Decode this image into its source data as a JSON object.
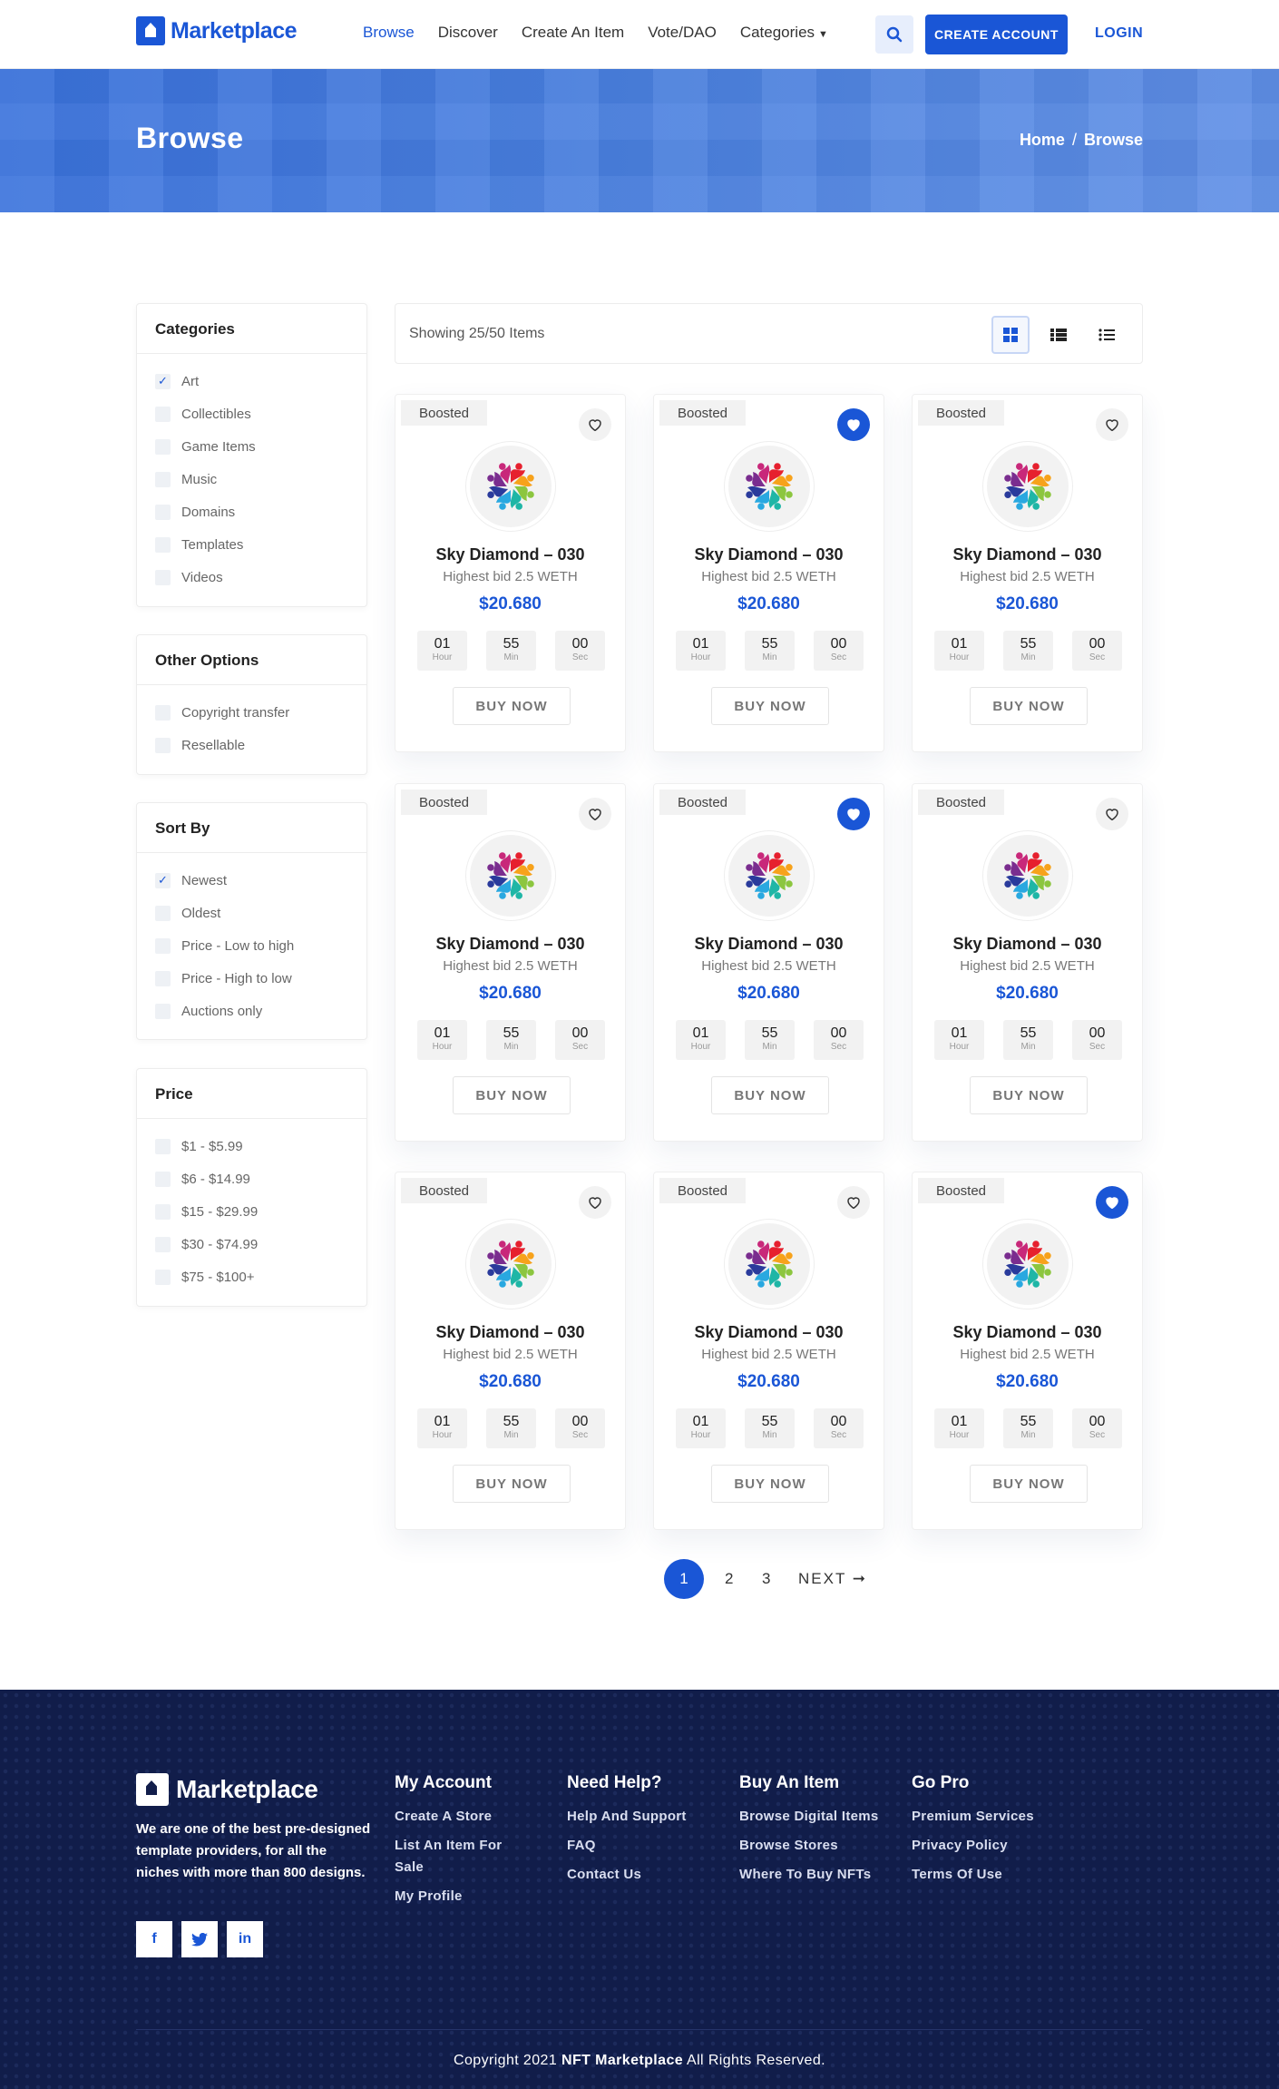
{
  "header": {
    "brand": "Marketplace",
    "nav": [
      "Browse",
      "Discover",
      "Create An Item",
      "Vote/DAO",
      "Categories"
    ],
    "create_account": "CREATE ACCOUNT",
    "login": "LOGIN"
  },
  "banner": {
    "title": "Browse",
    "breadcrumb_home": "Home",
    "breadcrumb_sep": "/",
    "breadcrumb_current": "Browse"
  },
  "sidebar": {
    "categories": {
      "title": "Categories",
      "items": [
        {
          "label": "Art",
          "checked": true
        },
        {
          "label": "Collectibles",
          "checked": false
        },
        {
          "label": "Game Items",
          "checked": false
        },
        {
          "label": "Music",
          "checked": false
        },
        {
          "label": "Domains",
          "checked": false
        },
        {
          "label": "Templates",
          "checked": false
        },
        {
          "label": "Videos",
          "checked": false
        }
      ]
    },
    "other": {
      "title": "Other Options",
      "items": [
        {
          "label": "Copyright transfer",
          "checked": false
        },
        {
          "label": "Resellable",
          "checked": false
        }
      ]
    },
    "sort": {
      "title": "Sort By",
      "items": [
        {
          "label": "Newest",
          "checked": true
        },
        {
          "label": "Oldest",
          "checked": false
        },
        {
          "label": "Price - Low to high",
          "checked": false
        },
        {
          "label": "Price - High to low",
          "checked": false
        },
        {
          "label": "Auctions only",
          "checked": false
        }
      ]
    },
    "price": {
      "title": "Price",
      "items": [
        {
          "label": "$1 - $5.99",
          "checked": false
        },
        {
          "label": "$6 - $14.99",
          "checked": false
        },
        {
          "label": "$15 - $29.99",
          "checked": false
        },
        {
          "label": "$30 - $74.99",
          "checked": false
        },
        {
          "label": "$75 - $100+",
          "checked": false
        }
      ]
    }
  },
  "results": {
    "showing": "Showing 25/50 Items"
  },
  "cards": [
    {
      "badge": "Boosted",
      "liked": false,
      "name": "Sky Diamond – 030",
      "bid": "Highest bid 2.5 WETH",
      "price": "$20.680",
      "hour": "01",
      "min": "55",
      "sec": "00",
      "buy": "BUY NOW"
    },
    {
      "badge": "Boosted",
      "liked": true,
      "name": "Sky Diamond – 030",
      "bid": "Highest bid 2.5 WETH",
      "price": "$20.680",
      "hour": "01",
      "min": "55",
      "sec": "00",
      "buy": "BUY NOW"
    },
    {
      "badge": "Boosted",
      "liked": false,
      "name": "Sky Diamond – 030",
      "bid": "Highest bid 2.5 WETH",
      "price": "$20.680",
      "hour": "01",
      "min": "55",
      "sec": "00",
      "buy": "BUY NOW"
    },
    {
      "badge": "Boosted",
      "liked": false,
      "name": "Sky Diamond – 030",
      "bid": "Highest bid 2.5 WETH",
      "price": "$20.680",
      "hour": "01",
      "min": "55",
      "sec": "00",
      "buy": "BUY NOW"
    },
    {
      "badge": "Boosted",
      "liked": true,
      "name": "Sky Diamond – 030",
      "bid": "Highest bid 2.5 WETH",
      "price": "$20.680",
      "hour": "01",
      "min": "55",
      "sec": "00",
      "buy": "BUY NOW"
    },
    {
      "badge": "Boosted",
      "liked": false,
      "name": "Sky Diamond – 030",
      "bid": "Highest bid 2.5 WETH",
      "price": "$20.680",
      "hour": "01",
      "min": "55",
      "sec": "00",
      "buy": "BUY NOW"
    },
    {
      "badge": "Boosted",
      "liked": false,
      "name": "Sky Diamond – 030",
      "bid": "Highest bid 2.5 WETH",
      "price": "$20.680",
      "hour": "01",
      "min": "55",
      "sec": "00",
      "buy": "BUY NOW"
    },
    {
      "badge": "Boosted",
      "liked": false,
      "name": "Sky Diamond – 030",
      "bid": "Highest bid 2.5 WETH",
      "price": "$20.680",
      "hour": "01",
      "min": "55",
      "sec": "00",
      "buy": "BUY NOW"
    },
    {
      "badge": "Boosted",
      "liked": true,
      "name": "Sky Diamond – 030",
      "bid": "Highest bid 2.5 WETH",
      "price": "$20.680",
      "hour": "01",
      "min": "55",
      "sec": "00",
      "buy": "BUY NOW"
    }
  ],
  "timer_labels": {
    "hour": "Hour",
    "min": "Min",
    "sec": "Sec"
  },
  "pagination": {
    "pages": [
      "1",
      "2",
      "3"
    ],
    "next": "NEXT"
  },
  "footer": {
    "brand": "Marketplace",
    "about": "We are one of the best pre-designed template providers, for all the niches with more than 800 designs.",
    "social": {
      "facebook": "f",
      "linkedin": "in"
    },
    "columns": [
      {
        "title": "My Account",
        "links": [
          "Create A Store",
          "List An Item For Sale",
          "My Profile"
        ]
      },
      {
        "title": "Need Help?",
        "links": [
          "Help And Support",
          "FAQ",
          "Contact Us"
        ]
      },
      {
        "title": "Buy An Item",
        "links": [
          "Browse Digital Items",
          "Browse Stores",
          "Where To Buy NFTs"
        ]
      },
      {
        "title": "Go Pro",
        "links": [
          "Premium Services",
          "Privacy Policy",
          "Terms Of Use"
        ]
      }
    ],
    "copyright_prefix": "Copyright 2021",
    "copyright_brand": "NFT Marketplace",
    "copyright_suffix": "All Rights Reserved."
  },
  "colors": {
    "accent": "#1a56d6",
    "footer_bg": "#111d4a",
    "banner": "#4b81e0"
  }
}
